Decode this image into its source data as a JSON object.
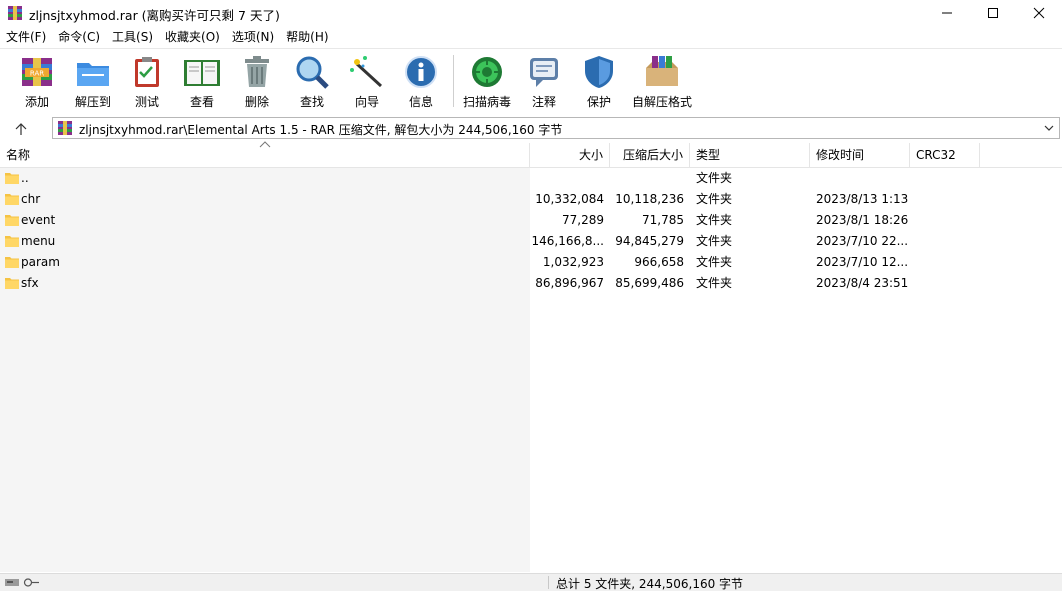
{
  "window": {
    "title": "zljnsjtxyhmod.rar (离购买许可只剩 7 天了)",
    "controls": {
      "minimize": "minimize-icon",
      "maximize": "maximize-icon",
      "close": "close-icon"
    }
  },
  "menu": [
    "文件(F)",
    "命令(C)",
    "工具(S)",
    "收藏夹(O)",
    "选项(N)",
    "帮助(H)"
  ],
  "toolbar": [
    {
      "label": "添加",
      "icon": "add-archive-icon"
    },
    {
      "label": "解压到",
      "icon": "extract-to-icon"
    },
    {
      "label": "测试",
      "icon": "test-icon"
    },
    {
      "label": "查看",
      "icon": "view-book-icon"
    },
    {
      "label": "删除",
      "icon": "trash-icon"
    },
    {
      "label": "查找",
      "icon": "magnifier-icon"
    },
    {
      "label": "向导",
      "icon": "wizard-wand-icon"
    },
    {
      "label": "信息",
      "icon": "info-icon"
    },
    {
      "label": "扫描病毒",
      "icon": "virus-scan-icon"
    },
    {
      "label": "注释",
      "icon": "comment-icon"
    },
    {
      "label": "保护",
      "icon": "shield-icon"
    },
    {
      "label": "自解压格式",
      "icon": "sfx-box-icon"
    }
  ],
  "address": {
    "path": "zljnsjtxyhmod.rar\\Elemental Arts 1.5 - RAR 压缩文件, 解包大小为 244,506,160 字节"
  },
  "columns": {
    "name": "名称",
    "size": "大小",
    "packed": "压缩后大小",
    "type": "类型",
    "modified": "修改时间",
    "crc": "CRC32"
  },
  "files": [
    {
      "name": "..",
      "size": "",
      "packed": "",
      "type": "文件夹",
      "modified": ""
    },
    {
      "name": "chr",
      "size": "10,332,084",
      "packed": "10,118,236",
      "type": "文件夹",
      "modified": "2023/8/13 1:13"
    },
    {
      "name": "event",
      "size": "77,289",
      "packed": "71,785",
      "type": "文件夹",
      "modified": "2023/8/1 18:26"
    },
    {
      "name": "menu",
      "size": "146,166,8...",
      "packed": "94,845,279",
      "type": "文件夹",
      "modified": "2023/7/10 22..."
    },
    {
      "name": "param",
      "size": "1,032,923",
      "packed": "966,658",
      "type": "文件夹",
      "modified": "2023/7/10 12..."
    },
    {
      "name": "sfx",
      "size": "86,896,967",
      "packed": "85,699,486",
      "type": "文件夹",
      "modified": "2023/8/4 23:51"
    }
  ],
  "status": {
    "text": "总计 5 文件夹, 244,506,160 字节"
  },
  "colors": {
    "folder": "#f5c344",
    "name_pane_bg": "#f5f5f5",
    "statusbar_bg": "#f0f0f0"
  }
}
